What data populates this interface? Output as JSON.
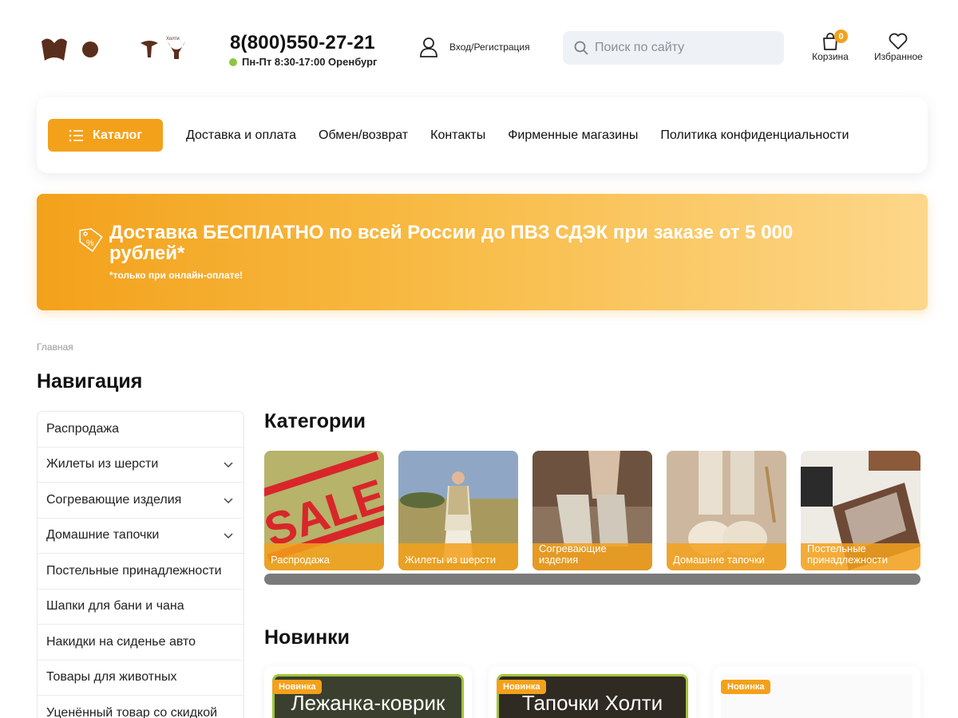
{
  "header": {
    "logo_alt": "Холти",
    "phone": "8(800)550-27-21",
    "hours": "Пн-Пт 8:30-17:00 Оренбург",
    "login_label": "Вход/Регистрация",
    "search_placeholder": "Поиск по сайту",
    "cart_label": "Корзина",
    "cart_count": "0",
    "favorites_label": "Избранное"
  },
  "navbar": {
    "catalog_label": "Каталог",
    "links": [
      "Доставка и оплата",
      "Обмен/возврат",
      "Контакты",
      "Фирменные магазины",
      "Политика конфиденциальности"
    ]
  },
  "promo": {
    "title": "Доставка БЕСПЛАТНО по всей России до ПВЗ СДЭК при заказе от 5 000 рублей*",
    "note": "*только при онлайн-оплате!"
  },
  "breadcrumb": "Главная",
  "sidebar": {
    "title": "Навигация",
    "items": [
      {
        "label": "Распродажа",
        "expandable": false
      },
      {
        "label": "Жилеты из шерсти",
        "expandable": true
      },
      {
        "label": "Согревающие изделия",
        "expandable": true
      },
      {
        "label": "Домашние тапочки",
        "expandable": true
      },
      {
        "label": "Постельные принадлежности",
        "expandable": false
      },
      {
        "label": "Шапки для бани и чана",
        "expandable": false
      },
      {
        "label": "Накидки на сиденье авто",
        "expandable": false
      },
      {
        "label": "Товары для животных",
        "expandable": false
      },
      {
        "label": "Уценённый товар со скидкой",
        "expandable": false
      }
    ]
  },
  "categories": {
    "title": "Категории",
    "sale_text": "SALE",
    "items": [
      "Распродажа",
      "Жилеты из шерсти",
      "Согревающие изделия",
      "Домашние тапочки",
      "Постельные принадлежности"
    ]
  },
  "new_items": {
    "title": "Новинки",
    "badge": "Новинка",
    "products": [
      "Лежанка-коврик",
      "Тапочки Холти",
      ""
    ]
  },
  "colors": {
    "accent": "#f3a11b",
    "accent_light": "#fdd78a",
    "status_dot": "#8ec641",
    "product_border": "#a4c43a"
  }
}
